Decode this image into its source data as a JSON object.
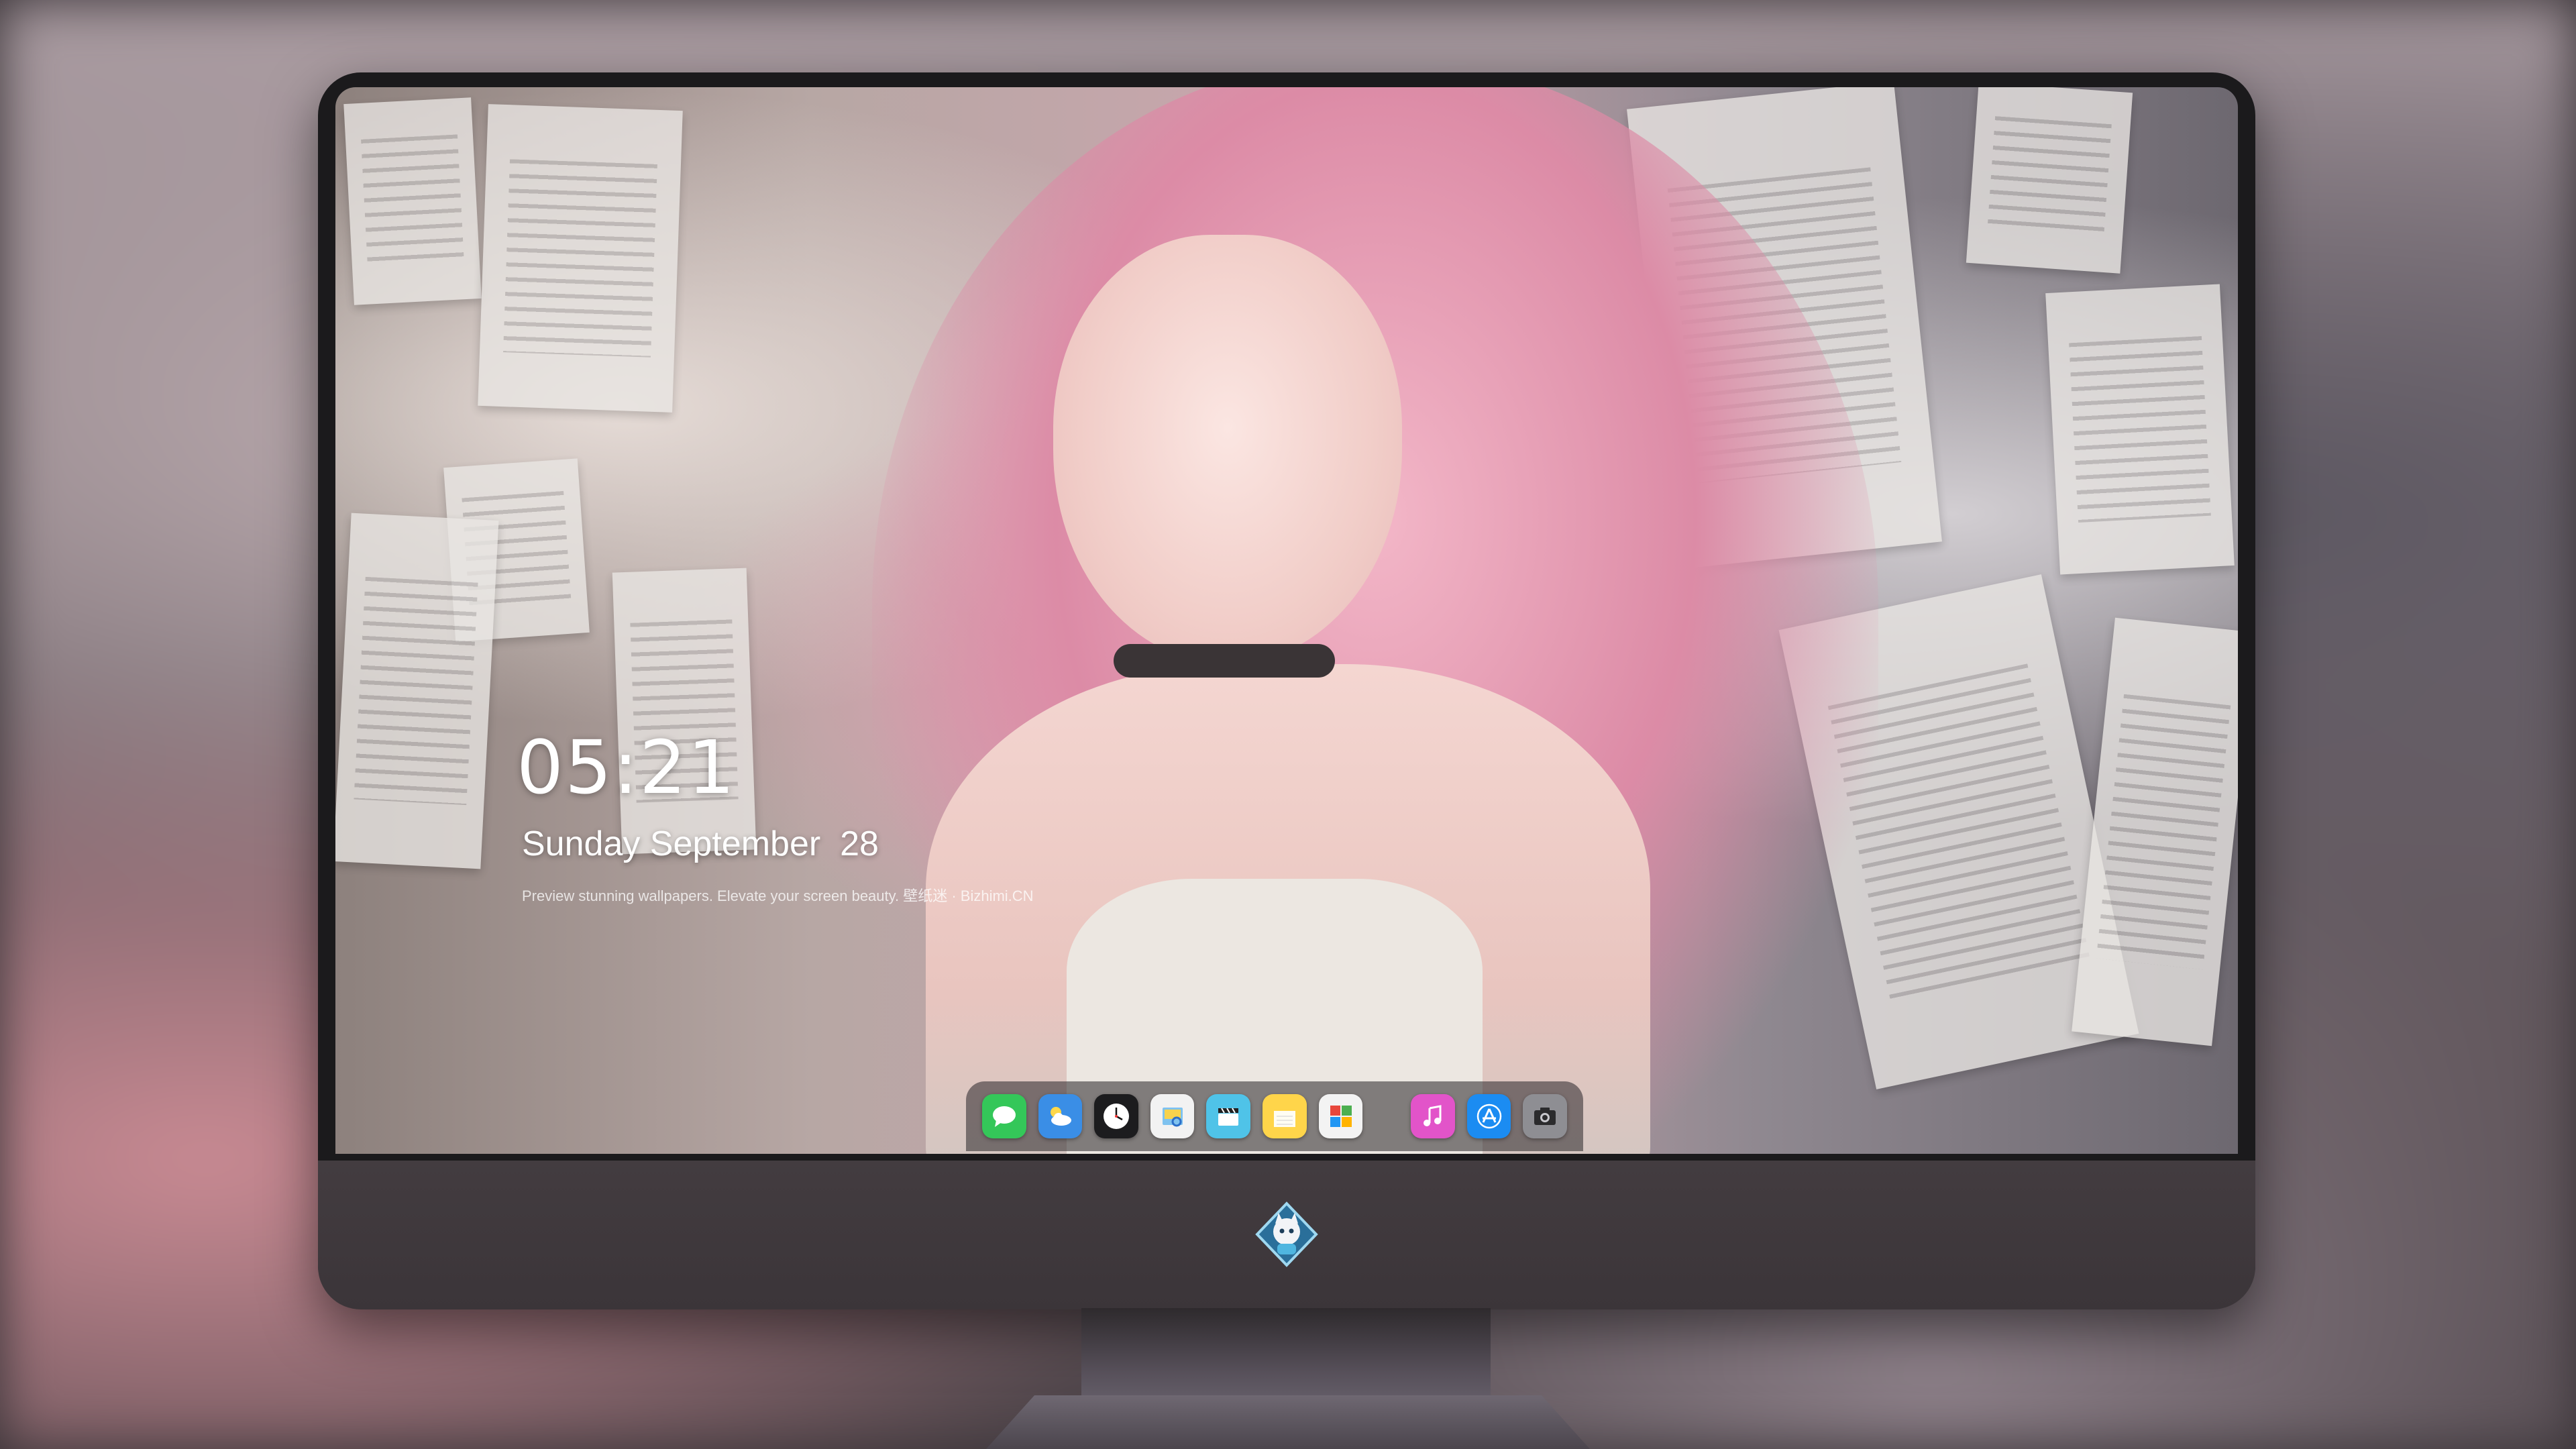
{
  "lockscreen": {
    "time": "05:21",
    "date": "Sunday September  28",
    "tagline": "Preview stunning wallpapers. Elevate your screen beauty. 壁纸迷 · Bizhimi.CN"
  },
  "dock": {
    "apps": [
      {
        "name": "Messages",
        "icon": "messages-icon",
        "color": "#34c759"
      },
      {
        "name": "Weather",
        "icon": "weather-icon",
        "color": "#3a8ee6"
      },
      {
        "name": "Clock",
        "icon": "clock-icon",
        "color": "#1c1c1e"
      },
      {
        "name": "Preview",
        "icon": "preview-icon",
        "color": "#f2f2f2"
      },
      {
        "name": "Clips",
        "icon": "clapperboard-icon",
        "color": "#4fc3e8"
      },
      {
        "name": "Notes",
        "icon": "notes-icon",
        "color": "#ffd54a"
      },
      {
        "name": "Photo Booth",
        "icon": "photo-grid-icon",
        "color": "#f3f3f3"
      },
      {
        "name": "iTunes",
        "icon": "music-note-icon",
        "color": "#e254c9"
      },
      {
        "name": "App Store",
        "icon": "app-store-icon",
        "color": "#1b8cf2"
      },
      {
        "name": "Camera",
        "icon": "camera-icon",
        "color": "#8e8e93"
      }
    ]
  },
  "brand": {
    "logo": "cat-mascot-logo-icon",
    "accent": "#4fb6e0"
  }
}
